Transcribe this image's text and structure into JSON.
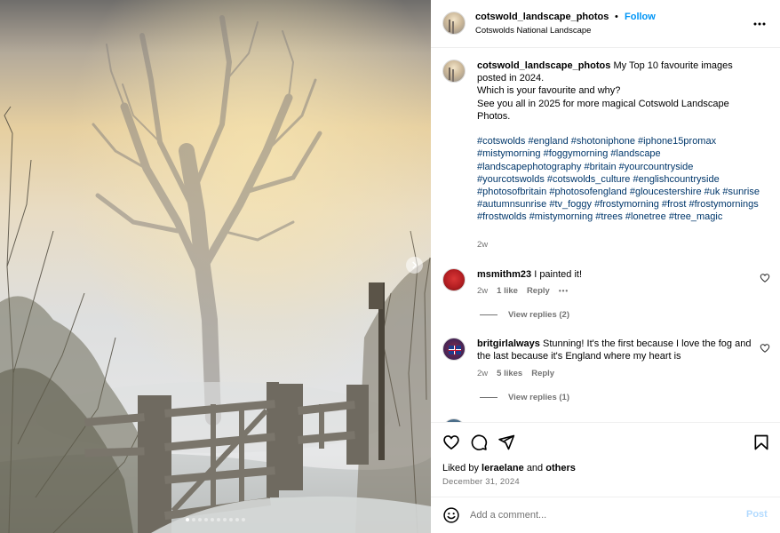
{
  "post": {
    "username": "cotswold_landscape_photos",
    "separator": "•",
    "follow_label": "Follow",
    "location": "Cotswolds National Landscape",
    "more_icon": "more-horizontal-icon"
  },
  "caption": {
    "username": "cotswold_landscape_photos",
    "line1": "My Top 10 favourite images posted in 2024.",
    "line2": "Which is your favourite and why?",
    "line3": "See you all in 2025 for more magical Cotswold Landscape Photos.",
    "hashtags": "#cotswolds #england #shotoniphone #iphone15promax #mistymorning #foggymorning #landscape #landscapephotography #britain #yourcountryside #yourcotswolds #cotswolds_culture #englishcountryside #photosofbritain #photosofengland #gloucestershire #uk #sunrise #autumnsunrise #tv_foggy #frostymorning #frost #frostymornings #frostwolds #mistymorning #trees #lonetree #tree_magic",
    "time": "2w"
  },
  "comments": [
    {
      "username": "msmithm23",
      "text": "I painted it!",
      "time": "2w",
      "likes": "1 like",
      "reply_label": "Reply",
      "more": "•••",
      "view_replies": "View replies (2)"
    },
    {
      "username": "britgirlalways",
      "text": "Stunning! It's the first because I love the fog and the last because it's England where my heart is",
      "time": "2w",
      "likes": "5 likes",
      "reply_label": "Reply",
      "view_replies": "View replies (1)"
    }
  ],
  "actions": {
    "liked_by_prefix": "Liked by",
    "liked_by_user": "leraelane",
    "liked_by_and": "and",
    "liked_by_others": "others",
    "date": "December 31, 2024"
  },
  "add_comment": {
    "placeholder": "Add a comment...",
    "post_label": "Post"
  },
  "carousel": {
    "total_slides": 10,
    "active_slide": 1
  },
  "colors": {
    "accent": "#0095f6",
    "hashtag": "#00376b",
    "muted": "#737373",
    "post_disabled": "#b3dbff"
  }
}
